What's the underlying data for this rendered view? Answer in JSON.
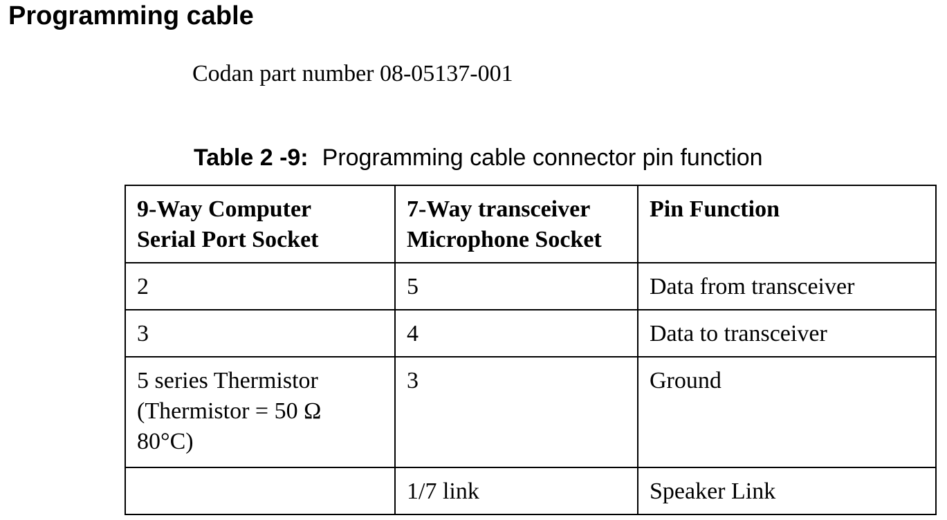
{
  "heading": "Programming cable",
  "part_number": "Codan part number 08-05137-001",
  "caption": {
    "label": "Table 2 -9:",
    "text": "Programming cable connector pin function"
  },
  "table": {
    "headers": [
      [
        "9-Way Computer",
        "Serial Port Socket"
      ],
      [
        "7-Way transceiver",
        "Microphone Socket"
      ],
      [
        "Pin Function"
      ]
    ],
    "rows": [
      {
        "c1": [
          "2"
        ],
        "c2": "5",
        "c3": "Data from transceiver"
      },
      {
        "c1": [
          "3"
        ],
        "c2": "4",
        "c3": "Data to transceiver"
      },
      {
        "c1": [
          "5 series Thermistor",
          "(Thermistor = 50 Ω",
          "80°C)"
        ],
        "c2": "3",
        "c3": "Ground"
      },
      {
        "c1": [
          ""
        ],
        "c2": "1/7 link",
        "c3": "Speaker Link"
      }
    ]
  }
}
